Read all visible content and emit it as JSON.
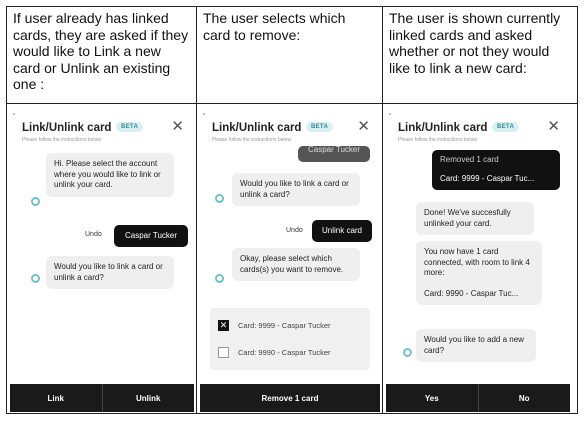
{
  "columns": [
    {
      "header": "If user already has linked cards, they are asked if they would like to Link a new card or Unlink an existing one :",
      "app": {
        "title": "Link/Unlink card",
        "badge": "BETA",
        "close": "✕",
        "instructions": "Please follow the instructions below"
      },
      "messages": {
        "bot1": "Hi. Please select the account where you would like to link or unlink your card.",
        "undo": "Undo",
        "user1": "Caspar Tucker",
        "bot2": "Would you like to link a card or unlink a card?"
      },
      "buttons": [
        "Link",
        "Unlink"
      ]
    },
    {
      "header": "The user selects which card to remove:",
      "app": {
        "title": "Link/Unlink card",
        "badge": "BETA",
        "close": "✕",
        "instructions": "Please follow the instructions below"
      },
      "messages": {
        "user_prev": "Caspar Tucker",
        "bot1": "Would you like to link a card or unlink a card?",
        "undo": "Undo",
        "user1": "Unlink card",
        "bot2": "Okay, please select which cards(s) you want to remove."
      },
      "cards": [
        {
          "label": "Card: 9999 - Caspar Tucker",
          "checked": true
        },
        {
          "label": "Card: 9990 - Caspar Tucker",
          "checked": false
        }
      ],
      "check_mark": "✕",
      "buttons": [
        "Remove 1 card"
      ]
    },
    {
      "header": "The user is shown currently linked cards and asked whether or not they would like to link a new card:",
      "app": {
        "title": "Link/Unlink card",
        "badge": "BETA",
        "close": "✕",
        "instructions": "Please follow the instructions below"
      },
      "messages": {
        "user_line1": "Removed 1 card",
        "user_line2": "Card: 9999 - Caspar Tuc...",
        "bot1": "Done! We've succesfully unlinked your card.",
        "bot2_line1": "You now have 1 card connected, with room to link 4 more:",
        "bot2_line2": "Card: 9990 - Caspar Tuc...",
        "bot3": "Would you like to add a new card?"
      },
      "buttons": [
        "Yes",
        "No"
      ]
    }
  ]
}
